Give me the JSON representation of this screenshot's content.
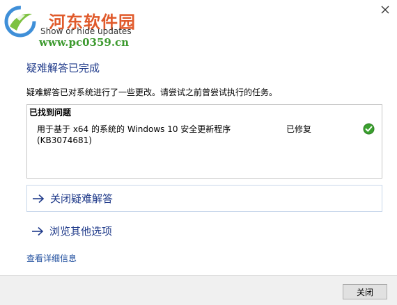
{
  "watermark": {
    "title": "河东软件园",
    "url": "www.pc0359.cn"
  },
  "window": {
    "title": "Show or hide updates"
  },
  "heading": "疑难解答已完成",
  "description": "疑难解答已对系统进行了一些更改。请尝试之前曾尝试执行的任务。",
  "problems": {
    "header": "已找到问题",
    "items": [
      {
        "name_line1": "用于基于 x64 的系统的 Windows 10 安全更新程序",
        "name_line2": "(KB3074681)",
        "status": "已修复",
        "icon": "check-icon"
      }
    ]
  },
  "links": {
    "close_troubleshooter": "关闭疑难解答",
    "browse_options": "浏览其他选项",
    "details": "查看详细信息"
  },
  "footer": {
    "close_label": "关闭"
  },
  "colors": {
    "link": "#1f3a8a",
    "status_ok": "#3aa02e",
    "accent_border": "#c7d6ea"
  }
}
